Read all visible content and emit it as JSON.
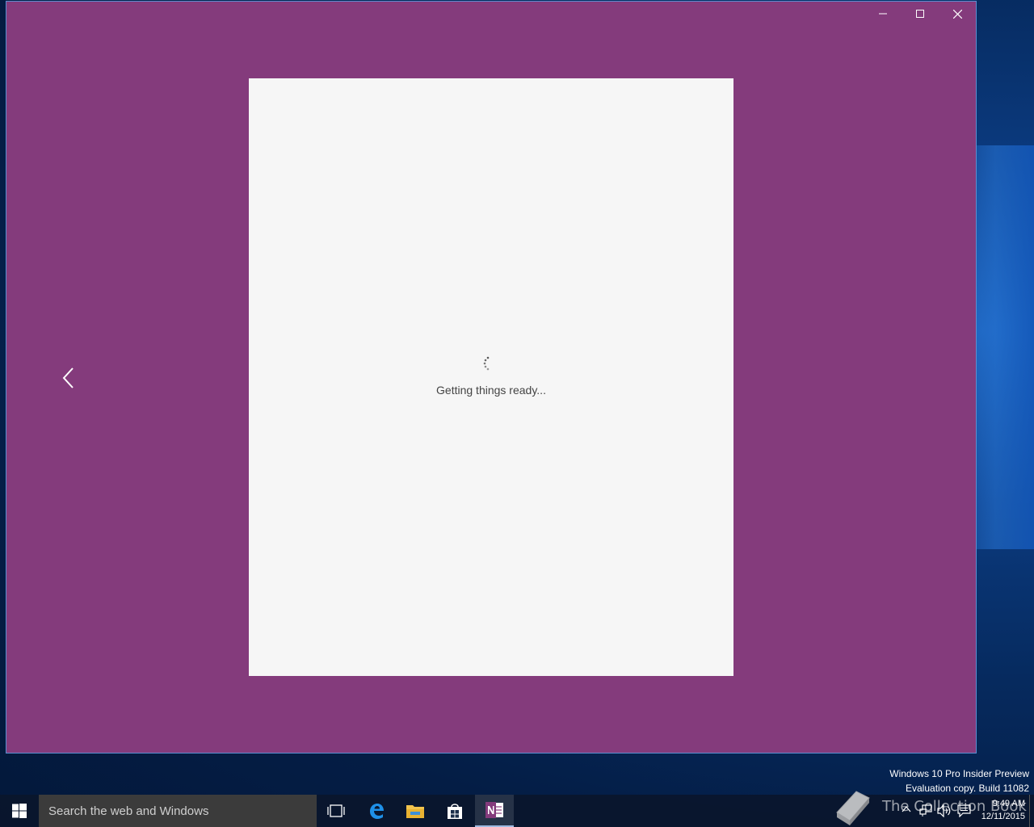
{
  "window": {
    "minimize_icon": "minimize-icon",
    "maximize_icon": "maximize-icon",
    "close_icon": "close-icon",
    "back_icon": "chevron-left-icon",
    "background_color": "#843b7c"
  },
  "page": {
    "loading_text": "Getting things ready...",
    "spinner_icon": "loading-spinner-icon",
    "card_color": "#f6f6f6"
  },
  "watermark": {
    "line1": "Windows 10 Pro Insider Preview",
    "line2": "Evaluation copy. Build 11082"
  },
  "taskbar": {
    "search_placeholder": "Search the web and Windows",
    "apps": [
      "start-icon",
      "task-view-icon",
      "edge-icon",
      "file-explorer-icon",
      "store-icon",
      "onenote-icon"
    ],
    "clock_time": "9:49 AM",
    "clock_date": "12/11/2015"
  },
  "overlay": {
    "brand_text": "The Collection Book",
    "brand_icon": "book-icon"
  }
}
